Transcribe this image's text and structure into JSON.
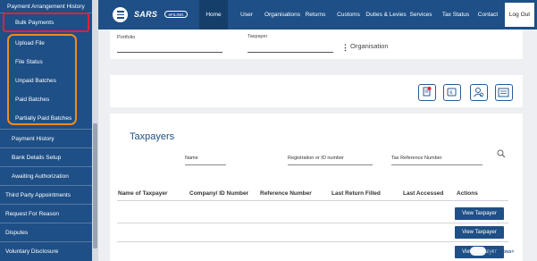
{
  "sidebar": {
    "items": [
      {
        "label": "Payment Arrangement History"
      },
      {
        "label": "Bulk Payments"
      },
      {
        "label": "Upload File"
      },
      {
        "label": "File Status"
      },
      {
        "label": "Unpaid Batches"
      },
      {
        "label": "Paid Batches"
      },
      {
        "label": "Partially Paid Batches"
      },
      {
        "label": "Payment History"
      },
      {
        "label": "Bank Details Setup"
      },
      {
        "label": "Awaiting Authorization"
      },
      {
        "label": "Third Party Appointments"
      },
      {
        "label": "Request For Reason"
      },
      {
        "label": "Disputes"
      },
      {
        "label": "Voluntary Disclosure"
      }
    ]
  },
  "topnav": {
    "logo": "SARS",
    "logo_sub": "eFILING",
    "items": [
      "Home",
      "User",
      "Organisations",
      "Returns",
      "Customs",
      "Duties & Levies",
      "Services",
      "Tax Status",
      "Contact"
    ],
    "logout": "Log Out"
  },
  "filter": {
    "portfolio_label": "Portfolio",
    "taxpayer_label": "Taxpayer",
    "org_label": "Organisation"
  },
  "icons": [
    "document-icon",
    "payment-icon",
    "user-search-icon",
    "calculator-icon"
  ],
  "taxpayers": {
    "title": "Taxpayers",
    "search": {
      "name": "Name",
      "registration": "Registration or ID number",
      "tax_reference": "Tax Reference Number"
    },
    "columns": [
      "Name of Taxpayer",
      "Company/ ID Number",
      "Reference Number",
      "Last Return Filled",
      "Last Accessed",
      "Actions"
    ],
    "view_button": "View Taxpayer",
    "overlay_text": "QUESTIONS?"
  },
  "colors": {
    "primary": "#1e4f86",
    "highlight_red": "#e0203a",
    "highlight_orange": "#f28a1c"
  }
}
